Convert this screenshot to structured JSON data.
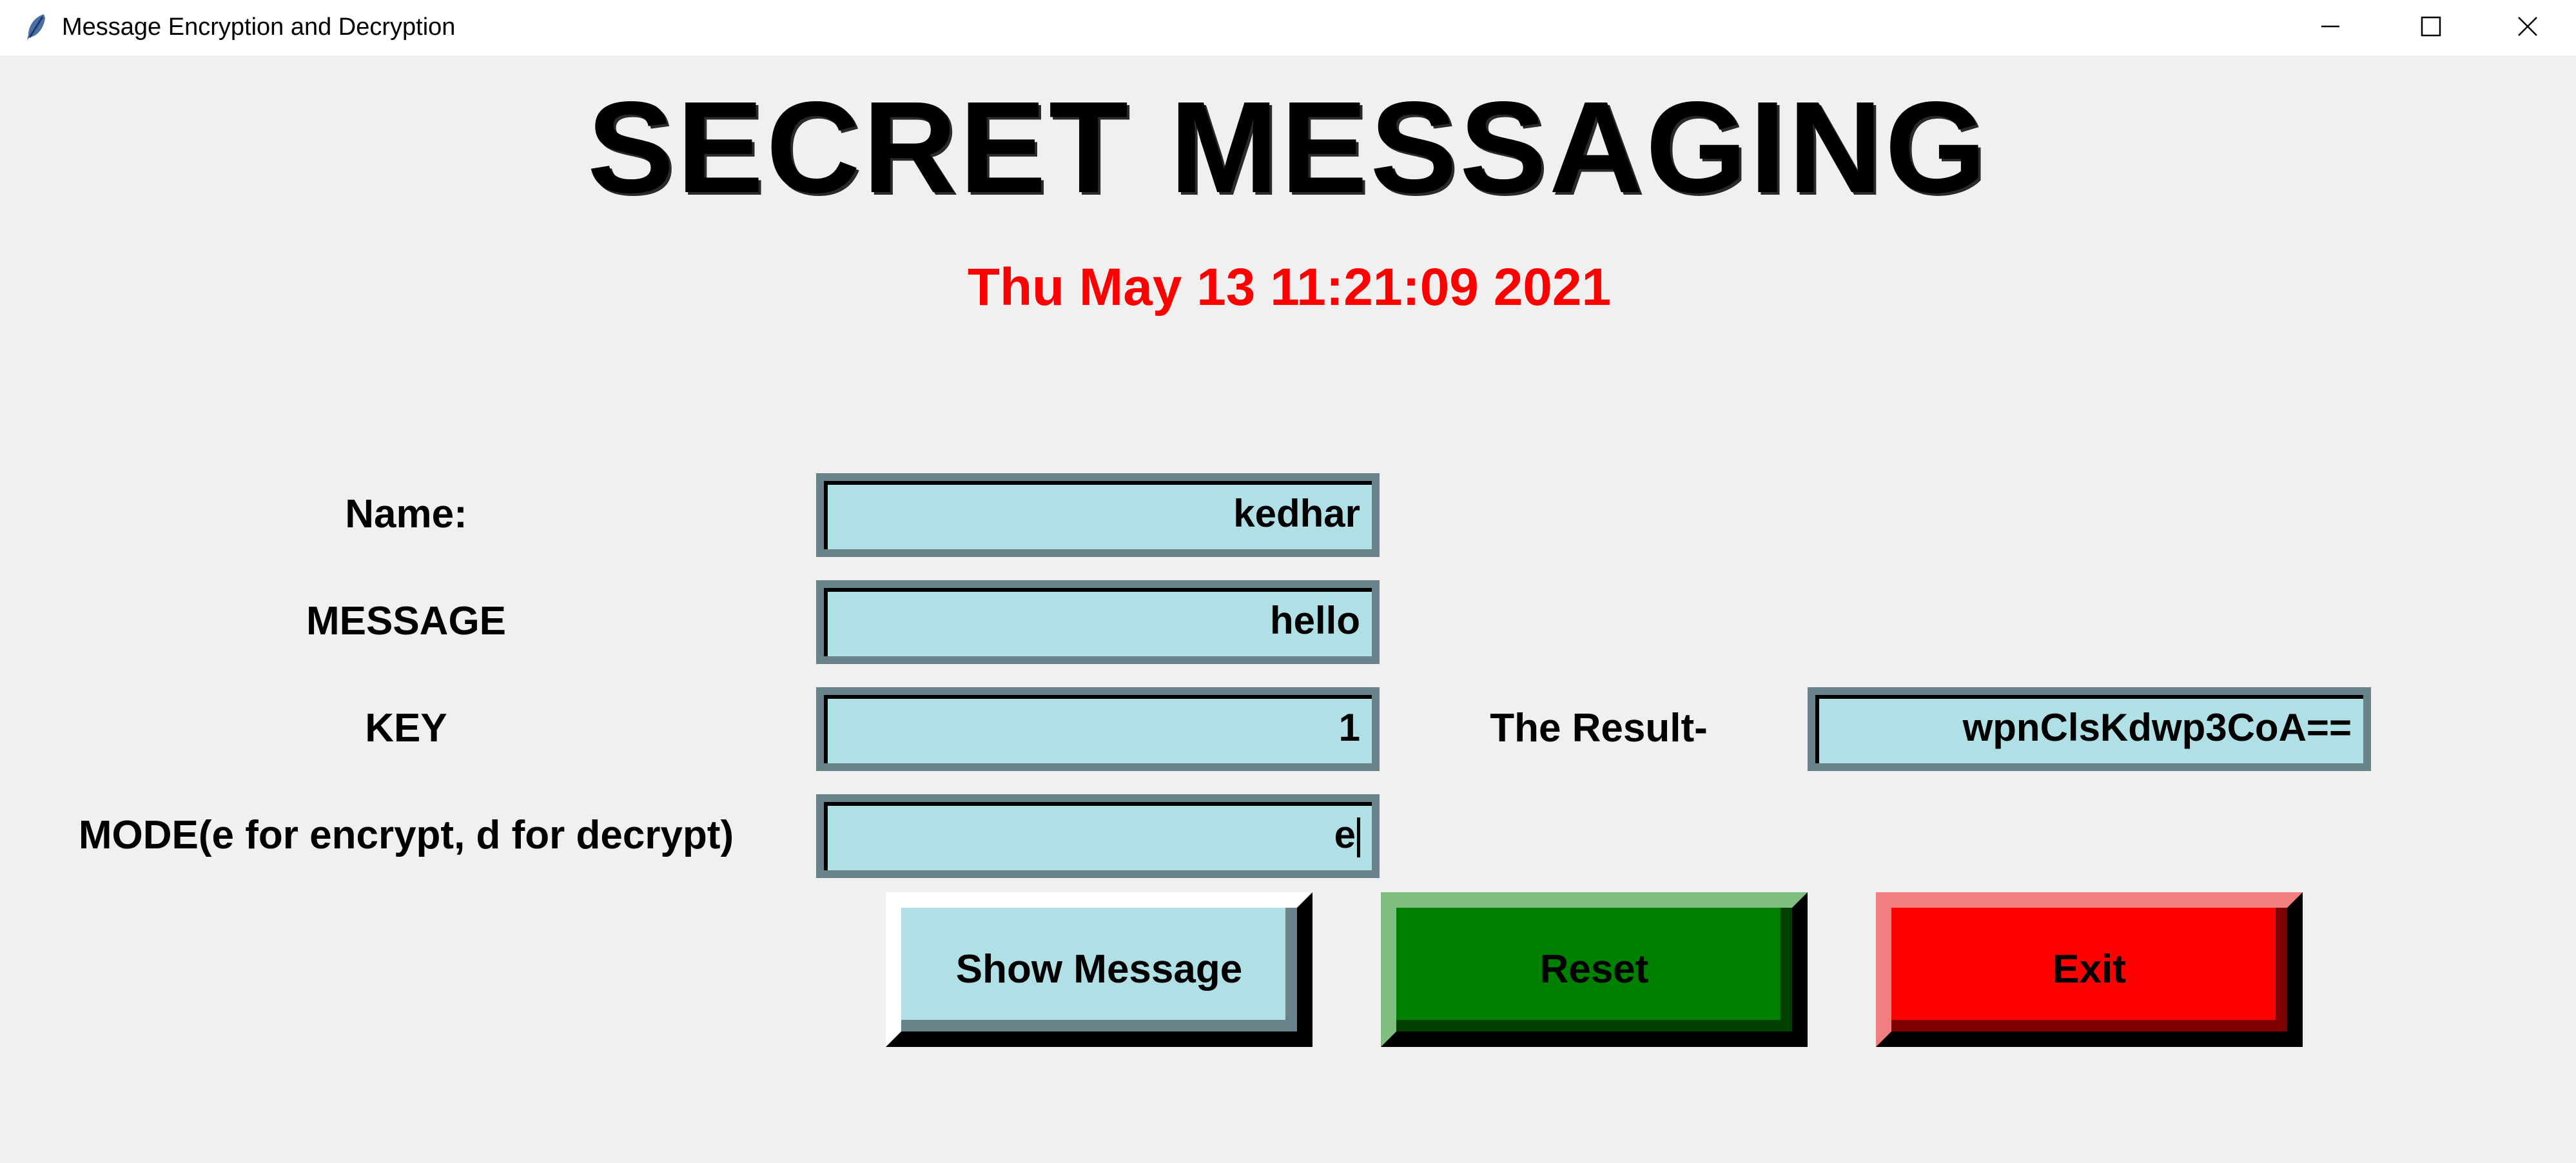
{
  "window": {
    "title": "Message Encryption and Decryption",
    "icon": "feather-icon",
    "controls": [
      "minimize-icon",
      "maximize-icon",
      "close-icon"
    ]
  },
  "header": {
    "title": "SECRET MESSAGING",
    "datetime": "Thu May 13 11:21:09 2021",
    "datetime_color": "#ff0000"
  },
  "form": {
    "name_label": "Name:",
    "name_value": "kedhar",
    "message_label": "MESSAGE",
    "message_value": "hello",
    "key_label": "KEY",
    "key_value": "1",
    "mode_label": "MODE(e for encrypt, d for decrypt)",
    "mode_value": "e",
    "result_label": "The Result-",
    "result_value": "wpnClsKdwp3CoA=="
  },
  "buttons": {
    "show_message": {
      "label": "Show Message",
      "color": "#b0e0e6"
    },
    "reset": {
      "label": "Reset",
      "color": "#008000"
    },
    "exit": {
      "label": "Exit",
      "color": "#ff0000"
    }
  },
  "colors": {
    "background": "#f0f0f0",
    "entry_background": "#b0e0e6"
  }
}
